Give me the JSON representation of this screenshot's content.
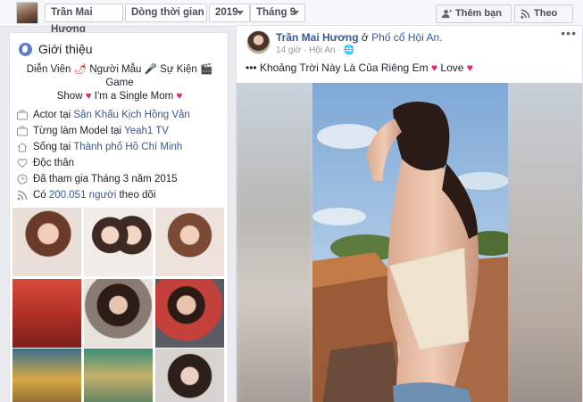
{
  "topbar": {
    "profile_name": "Trần Mai Hương",
    "timeline_label": "Dòng thời gian",
    "year": "2019",
    "month": "Tháng 9",
    "add_friend_label": "Thêm bạn bè",
    "follow_label": "Theo dõi"
  },
  "intro": {
    "title": "Giới thiệu",
    "bio_line1_a": "Diễn Viên",
    "bio_line1_b": "Người Mẫu",
    "bio_line1_c": "Sự Kiện",
    "bio_line1_d": "Game",
    "bio_line2_a": "Show",
    "bio_line2_b": "I'm a Single Mom",
    "rows": [
      {
        "prefix": "Actor tại ",
        "link": "Sân Khấu Kịch Hồng Vân",
        "icon": "briefcase-icon"
      },
      {
        "prefix": "Từng làm Model tại ",
        "link": "Yeah1 TV",
        "icon": "briefcase-icon"
      },
      {
        "prefix": "Sống tại ",
        "link": "Thành phố Hồ Chí Minh",
        "icon": "home-icon"
      },
      {
        "prefix": "Độc thân",
        "link": "",
        "icon": "heart-icon"
      },
      {
        "prefix": "Đã tham gia Tháng 3 năm 2015",
        "link": "",
        "icon": "clock-icon"
      },
      {
        "prefix": "Có ",
        "link": "200.051 người",
        "suffix": " theo dõi",
        "icon": "rss-icon"
      }
    ]
  },
  "post": {
    "author": "Trần Mai Hương",
    "at_word": " ở ",
    "place": "Phố cổ Hội An.",
    "time": "14 giờ",
    "location": "Hội An",
    "text_a": "••• Khoảng Trời Này Là Của Riêng Em",
    "text_b": "Love",
    "more": "•••"
  },
  "colors": {
    "link": "#385898",
    "heart": "#e0245e",
    "topbar_bg": "#f6f7f9",
    "page_bg": "#e9ebee"
  }
}
